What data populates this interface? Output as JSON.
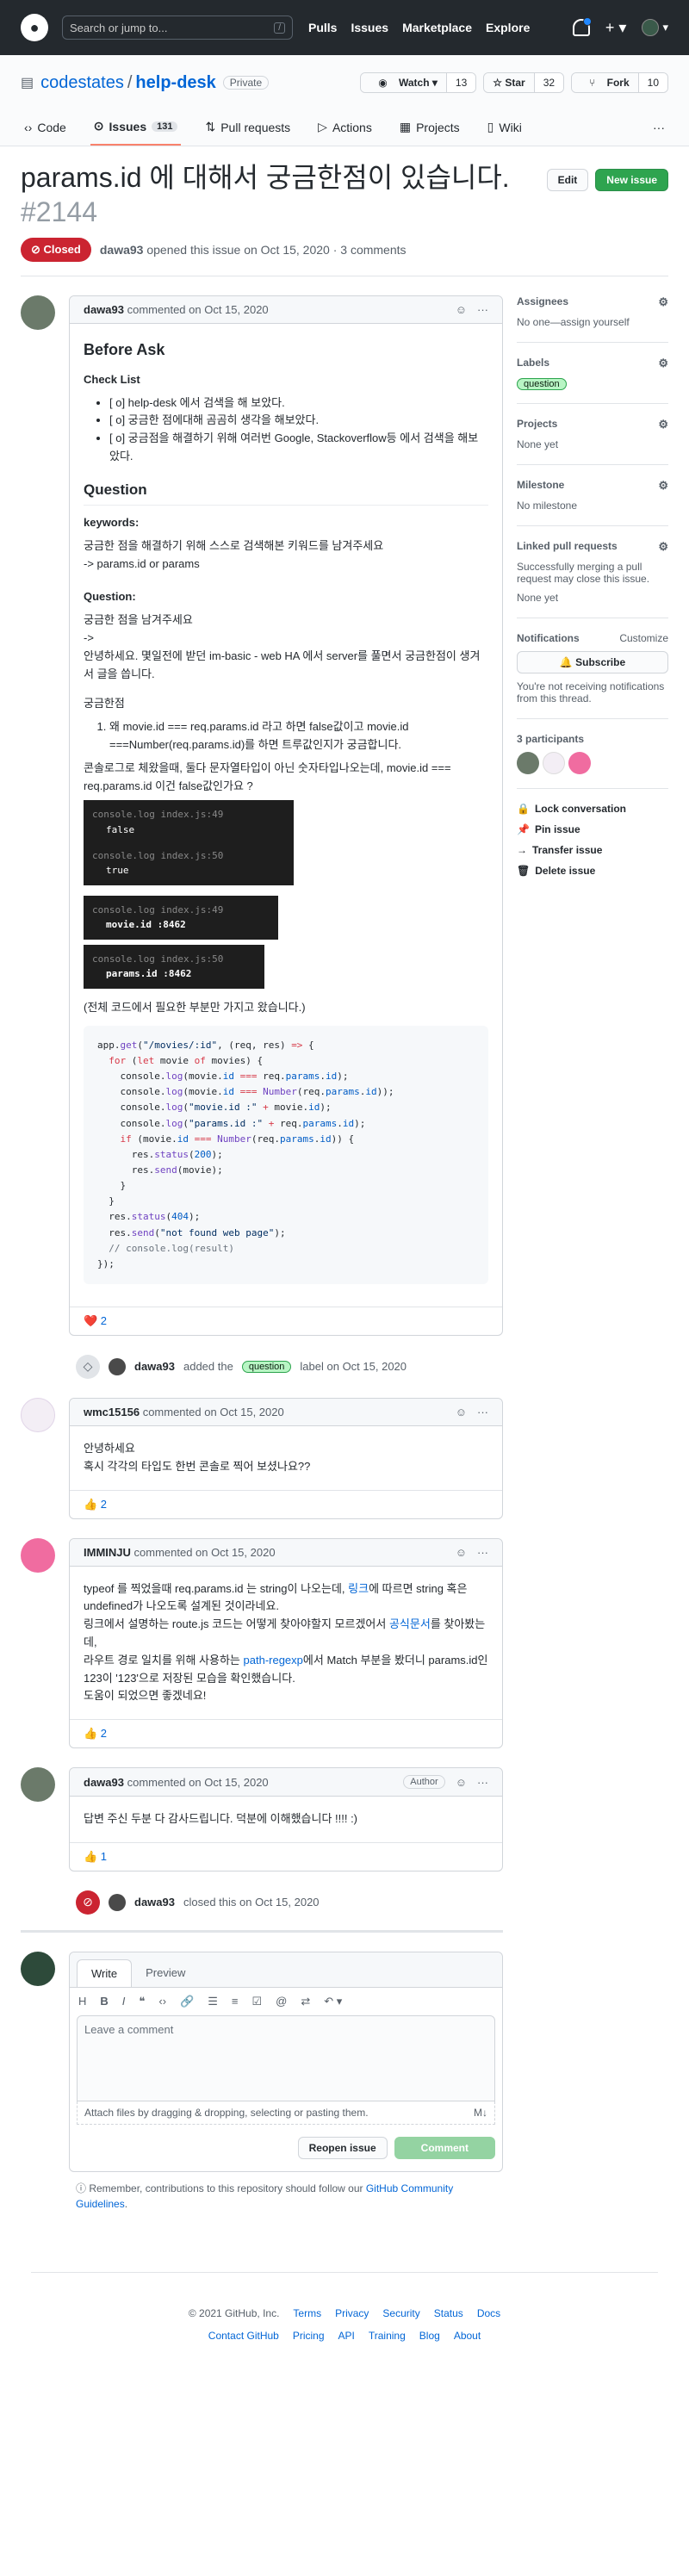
{
  "header": {
    "search_placeholder": "Search or jump to...",
    "slash_key": "/",
    "nav": [
      "Pulls",
      "Issues",
      "Marketplace",
      "Explore"
    ]
  },
  "repo": {
    "owner": "codestates",
    "sep": "/",
    "name": "help-desk",
    "visibility": "Private",
    "watch_label": "Watch ▾",
    "watch_count": "13",
    "star_label": "☆ Star",
    "star_count": "32",
    "fork_label": "Fork",
    "fork_count": "10",
    "tabs": [
      {
        "label": "Code"
      },
      {
        "label": "Issues",
        "count": "131"
      },
      {
        "label": "Pull requests"
      },
      {
        "label": "Actions"
      },
      {
        "label": "Projects"
      },
      {
        "label": "Wiki"
      }
    ]
  },
  "issue": {
    "title": "params.id 에 대해서 궁금한점이 있습니다.",
    "number": "#2144",
    "edit_label": "Edit",
    "new_issue_label": "New issue",
    "state": "Closed",
    "author": "dawa93",
    "opened_text": "opened this issue on Oct 15, 2020 · 3 comments"
  },
  "comment1": {
    "author": "dawa93",
    "meta": "commented on Oct 15, 2020",
    "h_before": "Before Ask",
    "h_check": "Check List",
    "checks": [
      "[ o] help-desk 에서 검색을 해 보았다.",
      "[ o] 궁금한 점에대해 곰곰히 생각을 해보았다.",
      "[ o] 궁금점을 해결하기 위해 여러번 Google, Stackoverflow등 에서 검색을 해보았다."
    ],
    "h_question": "Question",
    "keywords_label": "keywords:",
    "keywords_text1": "궁금한 점을 해결하기 위해 스스로 검색해본 키워드를 남겨주세요",
    "keywords_text2": "-> params.id or params",
    "question_label": "Question:",
    "q_text1": "궁금한 점을 남겨주세요",
    "q_text2": "->",
    "q_text3": "안녕하세요. 몇일전에 받던 im-basic - web HA 에서 server를 풀면서 궁금한점이 생겨서 글을 씁니다.",
    "q_text4": "궁금한점",
    "ol_item": "왜 movie.id === req.params.id 라고 하면 false값이고 movie.id ===Number(req.params.id)를 하면 트루값인지가 궁금합니다.",
    "console_text": "콘솔로그로 체왔을때, 둘다 문자열타입이 아닌 숫자타입나오는데, movie.id === req.params.id 이건 false값인가요 ?",
    "term1_l1": "console.log index.js:49",
    "term1_l2": "false",
    "term1_l3": "console.log index.js:50",
    "term1_l4": "true",
    "term2_l1": "console.log index.js:49",
    "term2_l2": "movie.id :8462",
    "term3_l1": "console.log index.js:50",
    "term3_l2": "params.id :8462",
    "code_note": "(전체 코드에서 필요한 부분만 가지고 왔습니다.)",
    "reaction": "❤️ 2"
  },
  "event_label": {
    "actor": "dawa93",
    "text1": "added the",
    "label": "question",
    "text2": "label on Oct 15, 2020"
  },
  "comment2": {
    "author": "wmc15156",
    "meta": "commented on Oct 15, 2020",
    "l1": "안녕하세요",
    "l2": "혹시 각각의 타입도 한번 콘솔로 찍어 보셨나요??",
    "reaction": "👍 2"
  },
  "comment3": {
    "author": "IMMINJU",
    "meta": "commented on Oct 15, 2020",
    "p1a": "typeof 를 찍었을때 req.params.id 는 string이 나오는데,",
    "p1link": "링크",
    "p1b": "에 따르면 string 혹은 undefined가 나오도록 설계된 것이라네요.",
    "p2a": "링크에서 설명하는 route.js 코드는 어떻게 찾아야할지 모르겠어서",
    "p2link": "공식문서",
    "p2b": "를 찾아봤는데,",
    "p3a": "라우트 경로 일치를 위해 사용하는",
    "p3link": "path-regexp",
    "p3b": "에서 Match 부분을 봤더니 params.id인 123이 '123'으로 저장된 모습을 확인했습니다.",
    "p4": "도움이 되었으면 좋겠네요!",
    "reaction": "👍 2"
  },
  "comment4": {
    "author": "dawa93",
    "meta": "commented on Oct 15, 2020",
    "badge": "Author",
    "text": "답변 주신 두분 다 감사드립니다. 덕분에 이해했습니다 !!!! :)",
    "reaction": "👍 1"
  },
  "event_closed": {
    "actor": "dawa93",
    "text": "closed this on Oct 15, 2020"
  },
  "editor": {
    "tab_write": "Write",
    "tab_preview": "Preview",
    "placeholder": "Leave a comment",
    "attach_text": "Attach files by dragging & dropping, selecting or pasting them.",
    "reopen_label": "Reopen issue",
    "comment_label": "Comment",
    "note_a": "Remember, contributions to this repository should follow our",
    "note_link": "GitHub Community Guidelines",
    "note_b": "."
  },
  "sidebar": {
    "assignees_title": "Assignees",
    "assignees_value": "No one—assign yourself",
    "labels_title": "Labels",
    "label_value": "question",
    "projects_title": "Projects",
    "projects_value": "None yet",
    "milestone_title": "Milestone",
    "milestone_value": "No milestone",
    "linked_title": "Linked pull requests",
    "linked_desc": "Successfully merging a pull request may close this issue.",
    "linked_value": "None yet",
    "notif_title": "Notifications",
    "notif_customize": "Customize",
    "subscribe_label": "Subscribe",
    "notif_desc": "You're not receiving notifications from this thread.",
    "participants_title": "3 participants",
    "lock": "Lock conversation",
    "pin": "Pin issue",
    "transfer": "Transfer issue",
    "delete": "Delete issue"
  },
  "footer": {
    "copyright": "© 2021 GitHub, Inc.",
    "row1": [
      "Terms",
      "Privacy",
      "Security",
      "Status",
      "Docs"
    ],
    "row2": [
      "Contact GitHub",
      "Pricing",
      "API",
      "Training",
      "Blog",
      "About"
    ]
  },
  "colors": {
    "closed": "#cb2431",
    "green": "#2ea44f",
    "header": "#24292e",
    "tab_accent": "#f9826c"
  }
}
